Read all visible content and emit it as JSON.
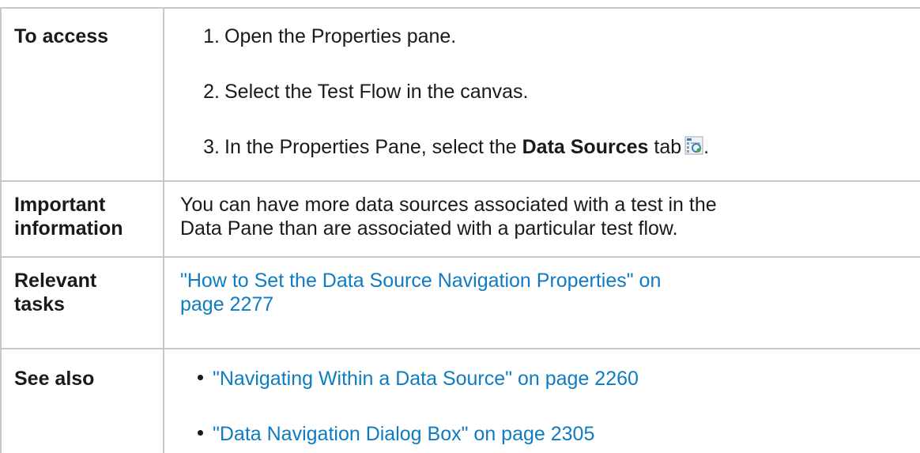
{
  "rows": {
    "access": {
      "label": "To access",
      "steps": [
        {
          "num": "1.",
          "text": "Open the Properties pane."
        },
        {
          "num": "2.",
          "text": "Select the Test Flow in the canvas."
        },
        {
          "num": "3.",
          "text_before": "In the Properties Pane, select the ",
          "bold": "Data Sources",
          "text_after": " tab",
          "end": ".",
          "icon": "data-sources-tab-icon"
        }
      ]
    },
    "important": {
      "label_line1": "Important",
      "label_line2": "information",
      "line1": "You can have more data sources associated with a test in the",
      "line2": "Data Pane than are associated with a particular test flow."
    },
    "relevant": {
      "label_line1": "Relevant",
      "label_line2": "tasks",
      "link_line1": "\"How to Set the Data Source Navigation Properties\" on",
      "link_line2": "page 2277"
    },
    "see_also": {
      "label": "See also",
      "links": [
        "\"Navigating Within a Data Source\" on page 2260",
        "\"Data Navigation Dialog Box\" on page 2305"
      ]
    }
  },
  "colors": {
    "link": "#0f7bc2",
    "border": "#c8c8c8",
    "text": "#1a1a1a"
  }
}
